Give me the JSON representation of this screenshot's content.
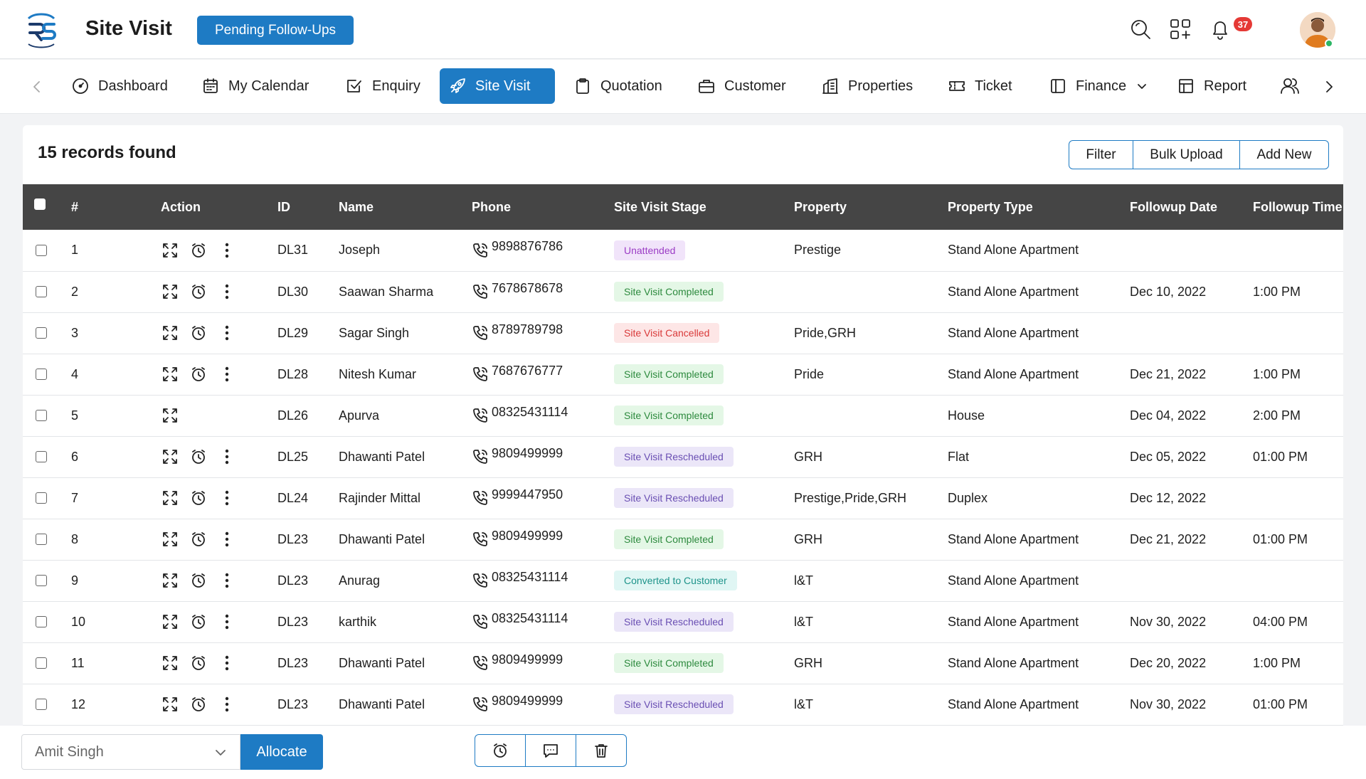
{
  "header": {
    "title": "Site Visit",
    "pending_label": "Pending Follow-Ups",
    "notification_count": "37"
  },
  "nav": {
    "items": [
      {
        "label": "Dashboard",
        "icon": "gauge-icon"
      },
      {
        "label": "My Calendar",
        "icon": "calendar-icon"
      },
      {
        "label": "Enquiry",
        "icon": "checkbox-icon"
      },
      {
        "label": "Site Visit",
        "icon": "rocket-icon",
        "active": true
      },
      {
        "label": "Quotation",
        "icon": "clipboard-icon"
      },
      {
        "label": "Customer",
        "icon": "briefcase-icon"
      },
      {
        "label": "Properties",
        "icon": "buildings-icon"
      },
      {
        "label": "Ticket",
        "icon": "ticket-icon"
      },
      {
        "label": "Finance",
        "icon": "sidebar-icon"
      },
      {
        "label": "Report",
        "icon": "table-icon"
      }
    ]
  },
  "main": {
    "records_label": "15 records found",
    "buttons": {
      "filter": "Filter",
      "bulk_upload": "Bulk Upload",
      "add_new": "Add New"
    },
    "columns": [
      "#",
      "Action",
      "ID",
      "Name",
      "Phone",
      "Site Visit Stage",
      "Property",
      "Property Type",
      "Followup Date",
      "Followup Time"
    ],
    "rows": [
      {
        "num": "1",
        "id": "DL31",
        "name": "Joseph",
        "phone": "9898876786",
        "stage": "Unattended",
        "property": "Prestige",
        "ptype": "Stand Alone Apartment",
        "date": "",
        "time": "",
        "has_alarm": true
      },
      {
        "num": "2",
        "id": "DL30",
        "name": "Saawan Sharma",
        "phone": "7678678678",
        "stage": "Site Visit Completed",
        "property": "",
        "ptype": "Stand Alone Apartment",
        "date": "Dec 10, 2022",
        "time": "1:00 PM",
        "has_alarm": true
      },
      {
        "num": "3",
        "id": "DL29",
        "name": "Sagar Singh",
        "phone": "8789789798",
        "stage": "Site Visit Cancelled",
        "property": "Pride,GRH",
        "ptype": "Stand Alone Apartment",
        "date": "",
        "time": "",
        "has_alarm": true
      },
      {
        "num": "4",
        "id": "DL28",
        "name": "Nitesh Kumar",
        "phone": "7687676777",
        "stage": "Site Visit Completed",
        "property": "Pride",
        "ptype": "Stand Alone Apartment",
        "date": "Dec 21, 2022",
        "time": "1:00 PM",
        "has_alarm": true
      },
      {
        "num": "5",
        "id": "DL26",
        "name": "Apurva",
        "phone": "08325431114",
        "stage": "Site Visit Completed",
        "property": "",
        "ptype": "House",
        "date": "Dec 04, 2022",
        "time": "2:00 PM",
        "has_alarm": false
      },
      {
        "num": "6",
        "id": "DL25",
        "name": "Dhawanti Patel",
        "phone": "9809499999",
        "stage": "Site Visit Rescheduled",
        "property": "GRH",
        "ptype": "Flat",
        "date": "Dec 05, 2022",
        "time": "01:00 PM",
        "has_alarm": true
      },
      {
        "num": "7",
        "id": "DL24",
        "name": "Rajinder Mittal",
        "phone": "9999447950",
        "stage": "Site Visit Rescheduled",
        "property": "Prestige,Pride,GRH",
        "ptype": "Duplex",
        "date": "Dec 12, 2022",
        "time": "",
        "has_alarm": true
      },
      {
        "num": "8",
        "id": "DL23",
        "name": "Dhawanti Patel",
        "phone": "9809499999",
        "stage": "Site Visit Completed",
        "property": "GRH",
        "ptype": "Stand Alone Apartment",
        "date": "Dec 21, 2022",
        "time": "01:00 PM",
        "has_alarm": true
      },
      {
        "num": "9",
        "id": "DL23",
        "name": "Anurag",
        "phone": "08325431114",
        "stage": "Converted to Customer",
        "property": "l&T",
        "ptype": "Stand Alone Apartment",
        "date": "",
        "time": "",
        "has_alarm": true
      },
      {
        "num": "10",
        "id": "DL23",
        "name": "karthik",
        "phone": "08325431114",
        "stage": "Site Visit Rescheduled",
        "property": "l&T",
        "ptype": "Stand Alone Apartment",
        "date": "Nov 30, 2022",
        "time": "04:00 PM",
        "has_alarm": true
      },
      {
        "num": "11",
        "id": "DL23",
        "name": "Dhawanti Patel",
        "phone": "9809499999",
        "stage": "Site Visit Completed",
        "property": "GRH",
        "ptype": "Stand Alone Apartment",
        "date": "Dec 20, 2022",
        "time": "1:00 PM",
        "has_alarm": true
      },
      {
        "num": "12",
        "id": "DL23",
        "name": "Dhawanti Patel",
        "phone": "9809499999",
        "stage": "Site Visit Rescheduled",
        "property": "l&T",
        "ptype": "Stand Alone Apartment",
        "date": "Nov 30, 2022",
        "time": "01:00 PM",
        "has_alarm": true
      }
    ],
    "stage_colors": {
      "Unattended": {
        "bg": "#f1e4fa",
        "fg": "#9b3cc5"
      },
      "Site Visit Completed": {
        "bg": "#e4f7e6",
        "fg": "#2d8a3e"
      },
      "Site Visit Cancelled": {
        "bg": "#fde6e6",
        "fg": "#d93a3a"
      },
      "Site Visit Rescheduled": {
        "bg": "#ebe6f8",
        "fg": "#6a4fb3"
      },
      "Converted to Customer": {
        "bg": "#e0f6f4",
        "fg": "#1d938a"
      }
    }
  },
  "footer": {
    "selected_user": "Amit Singh",
    "allocate_label": "Allocate"
  },
  "colors": {
    "accent": "#1e7bc4",
    "table_header": "#454545"
  }
}
